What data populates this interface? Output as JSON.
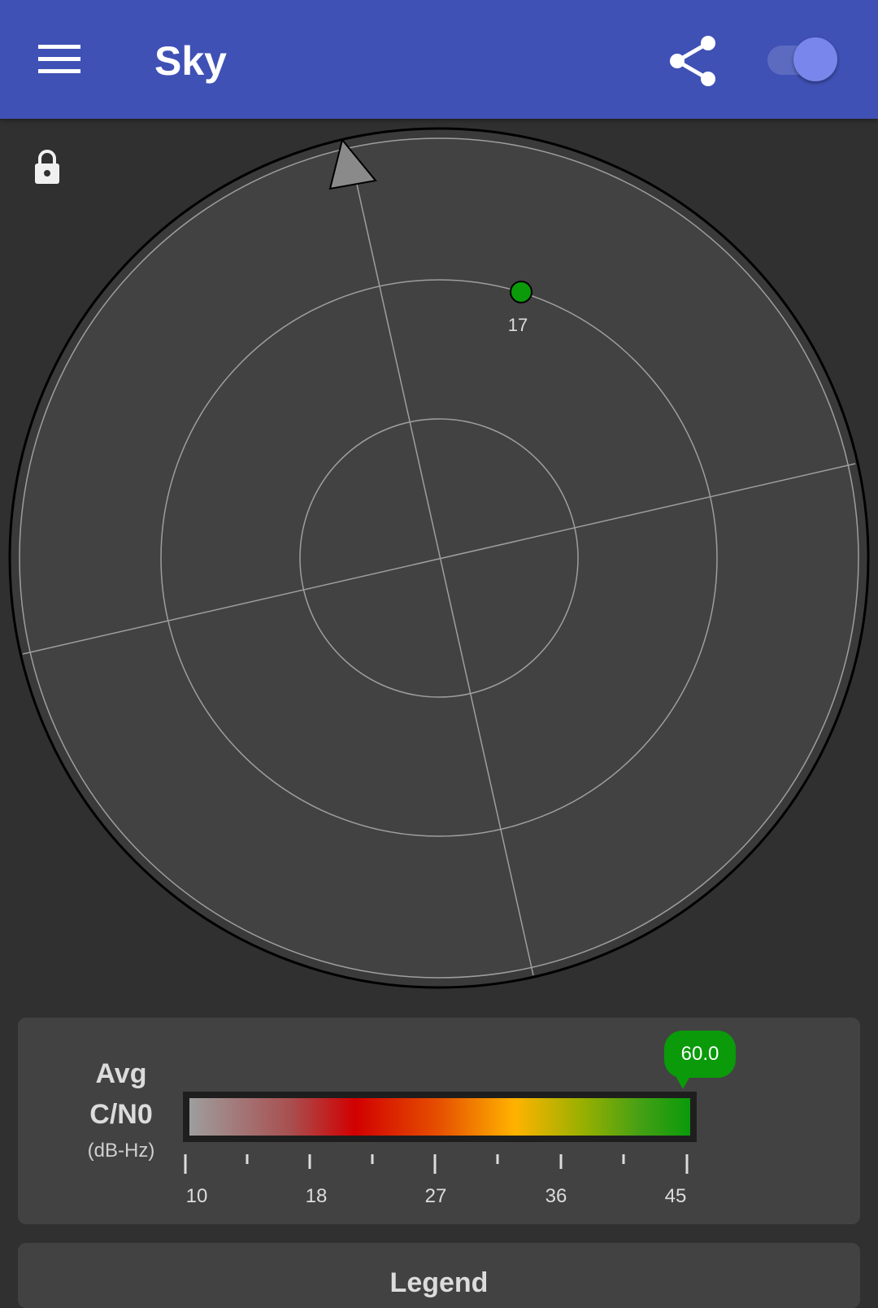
{
  "appbar": {
    "title": "Sky",
    "menu_icon": "menu-icon",
    "share_icon": "share-icon",
    "toggle_on": true,
    "color": "#3f51b5"
  },
  "sky": {
    "lock_icon": "lock-icon",
    "satellites": [
      {
        "id": "17",
        "color": "#0a9a0a"
      }
    ]
  },
  "cn0": {
    "label_line1": "Avg",
    "label_line2": "C/N0",
    "label_units": "(dB-Hz)",
    "value": "60.0",
    "ticks": [
      "10",
      "18",
      "27",
      "36",
      "45"
    ],
    "bubble_color": "#0a9a0a"
  },
  "legend": {
    "title": "Legend"
  }
}
